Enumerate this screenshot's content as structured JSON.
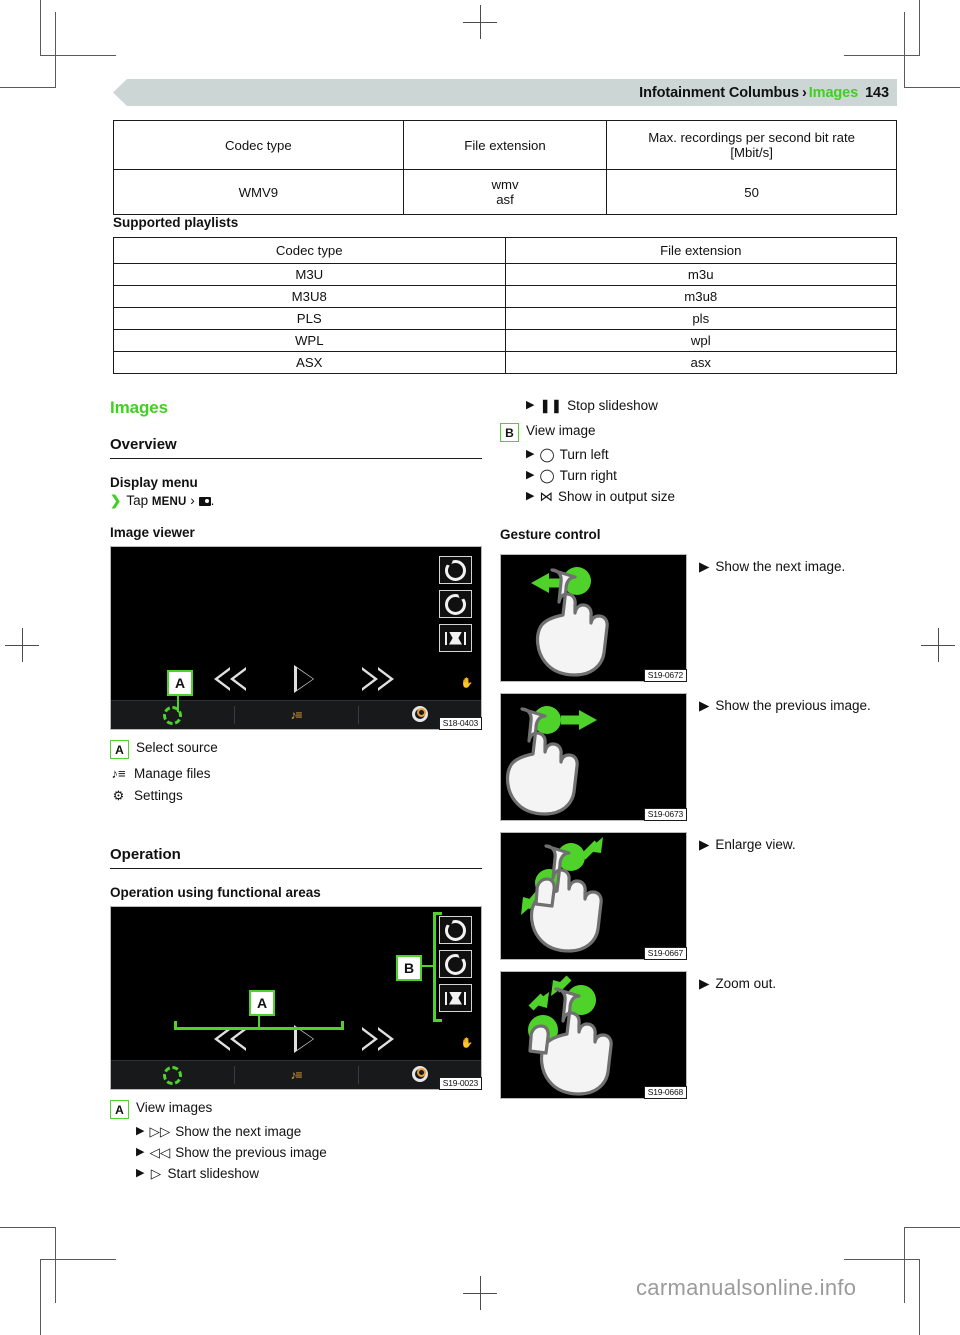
{
  "header": {
    "manual_title": "Infotainment Columbus",
    "separator": "›",
    "section": "Images",
    "page_number": "143"
  },
  "codec_table": {
    "columns": [
      "Codec type",
      "File extension",
      "Max. recordings per second bit rate [Mbit/s]"
    ],
    "col3_line1": "Max. recordings per second bit rate",
    "col3_line2": "[Mbit/s]",
    "rows": [
      {
        "codec": "WMV9",
        "ext_line1": "wmv",
        "ext_line2": "asf",
        "bitrate": "50"
      }
    ]
  },
  "playlists": {
    "heading": "Supported playlists",
    "columns": [
      "Codec type",
      "File extension"
    ],
    "rows": [
      [
        "M3U",
        "m3u"
      ],
      [
        "M3U8",
        "m3u8"
      ],
      [
        "PLS",
        "pls"
      ],
      [
        "WPL",
        "wpl"
      ],
      [
        "ASX",
        "asx"
      ]
    ]
  },
  "left": {
    "section_title": "Images",
    "overview_title": "Overview",
    "display_menu_title": "Display menu",
    "display_menu_step_prefix": "Tap",
    "display_menu_word": "MENU",
    "display_menu_sep": "›",
    "display_menu_suffix": ".",
    "image_viewer_title": "Image viewer",
    "viewer_shot_code": "S18-0403",
    "viewer_marker_a": "A",
    "legend": [
      {
        "badge": "A",
        "icon": "",
        "label": "Select source"
      },
      {
        "badge": "",
        "icon": "♪≡",
        "label": "Manage files"
      },
      {
        "badge": "",
        "icon": "⚙",
        "label": "Settings"
      }
    ],
    "operation_title": "Operation",
    "functional_areas_title": "Operation using functional areas",
    "functional_shot_code": "S19-0023",
    "functional_marker_a": "A",
    "functional_marker_b": "B",
    "view_images_badge": "A",
    "view_images_label": "View images",
    "view_images_items": [
      {
        "icon": "▷▷",
        "label": "Show the next image"
      },
      {
        "icon": "◁◁",
        "label": "Show the previous image"
      },
      {
        "icon": "▷",
        "label": "Start slideshow"
      }
    ]
  },
  "right": {
    "stop_slideshow": {
      "icon": "❚❚",
      "label": "Stop slideshow"
    },
    "view_image_badge": "B",
    "view_image_label": "View image",
    "view_image_items": [
      {
        "icon": "◯",
        "label": "Turn left"
      },
      {
        "icon": "◯",
        "label": "Turn right"
      },
      {
        "icon": "⋈",
        "label": "Show in output size"
      }
    ],
    "gesture_control_title": "Gesture control",
    "gestures": [
      {
        "code": "S19-0672",
        "label": "Show the next image.",
        "type": "swipe-left"
      },
      {
        "code": "S19-0673",
        "label": "Show the previous image.",
        "type": "swipe-right"
      },
      {
        "code": "S19-0667",
        "label": "Enlarge view.",
        "type": "pinch-open"
      },
      {
        "code": "S19-0668",
        "label": "Zoom out.",
        "type": "pinch-close"
      }
    ]
  },
  "footer": {
    "watermark": "carmanualsonline.info"
  },
  "colors": {
    "accent_green": "#3fd020",
    "device_green": "#4fd32b",
    "header_band": "#ccd6d4",
    "amber": "#e8a13a"
  }
}
